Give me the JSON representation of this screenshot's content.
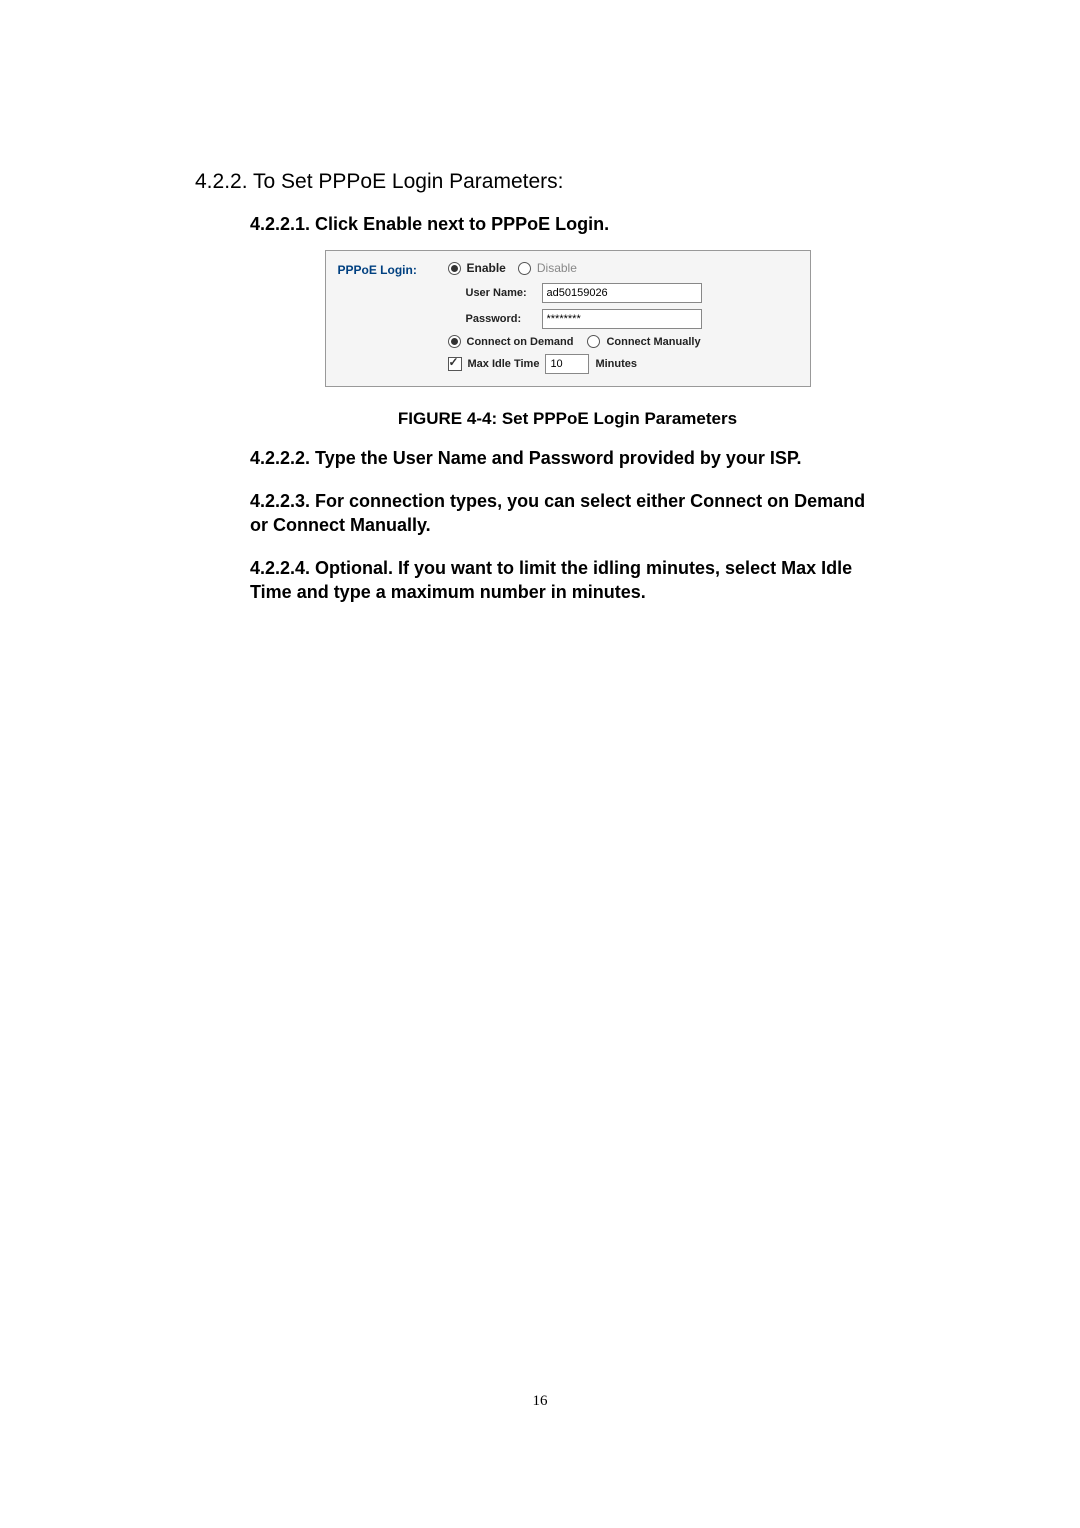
{
  "section_heading": "4.2.2. To Set PPPoE Login Parameters:",
  "sub1": "4.2.2.1. Click Enable next to PPPoE Login.",
  "figure": {
    "title": "PPPoE Login:",
    "enable": "Enable",
    "disable": "Disable",
    "user_name_label": "User Name:",
    "user_name_value": "ad50159026",
    "password_label": "Password:",
    "password_value": "********",
    "connect_on_demand": "Connect on Demand",
    "connect_manually": "Connect Manually",
    "max_idle_label": "Max Idle Time",
    "max_idle_value": "10",
    "minutes": "Minutes"
  },
  "figure_caption": "FIGURE 4-4: Set PPPoE Login Parameters",
  "sub2": "4.2.2.2. Type the User Name and Password provided by your ISP.",
  "sub3": "4.2.2.3. For connection types, you can select either Connect on Demand or Connect Manually.",
  "sub4": "4.2.2.4. Optional. If you want to limit the idling minutes, select Max Idle Time and type a maximum number in minutes.",
  "page_number": "16"
}
